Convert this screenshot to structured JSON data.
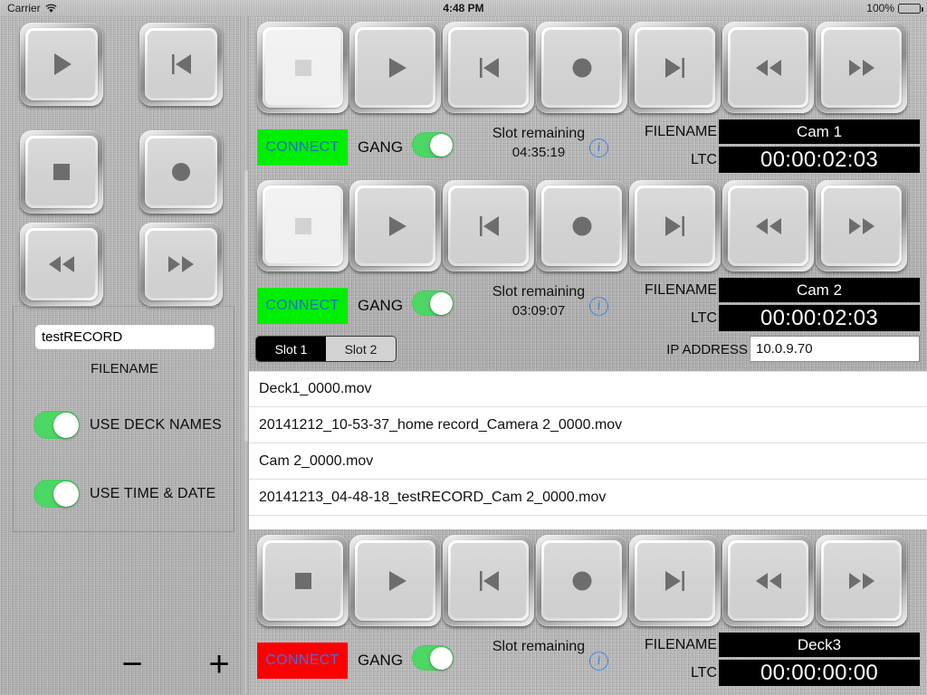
{
  "statusbar": {
    "carrier": "Carrier",
    "time": "4:48 PM",
    "battery_pct": "100%"
  },
  "sidebar": {
    "transport_keys": [
      {
        "name": "play",
        "icon": "play-icon"
      },
      {
        "name": "prev",
        "icon": "skip-previous-icon"
      },
      {
        "name": "stop",
        "icon": "stop-icon"
      },
      {
        "name": "record",
        "icon": "record-icon"
      },
      {
        "name": "rewind",
        "icon": "rewind-icon"
      },
      {
        "name": "forward",
        "icon": "fast-forward-icon"
      }
    ],
    "filename_value": "testRECORD",
    "filename_placeholder": "FILENAME",
    "filename_label": "FILENAME",
    "toggles": [
      {
        "label": "USE DECK NAMES",
        "on": true
      },
      {
        "label": "USE TIME & DATE",
        "on": true
      }
    ],
    "minus_label": "−",
    "plus_label": "+"
  },
  "main": {
    "transport_icons": [
      "stop-icon",
      "play-icon",
      "skip-previous-icon",
      "record-icon",
      "skip-next-icon",
      "rewind-icon",
      "fast-forward-icon"
    ],
    "labels": {
      "connect": "CONNECT",
      "gang": "GANG",
      "slot_remaining": "Slot remaining",
      "filename": "FILENAME",
      "ltc": "LTC",
      "info": "i",
      "ip_address": "IP ADDRESS"
    },
    "colors": {
      "connect_on_bg": "#00ef00",
      "connect_off_bg": "#fc0000",
      "connect_text": "#1e6fbe",
      "switch_on": "#4cd764",
      "display_bg": "#000000",
      "display_text": "#ffffff",
      "info_blue": "#3e86e0"
    },
    "decks": [
      {
        "connect_label": "CONNECT",
        "connected": true,
        "gang_on": true,
        "slot_remaining_label": "Slot remaining",
        "slot_remaining_value": "04:35:19",
        "filename_label": "FILENAME",
        "filename_value": "Cam 1",
        "ltc_label": "LTC",
        "ltc_value": "00:00:02:03",
        "active_transport": 0
      },
      {
        "connect_label": "CONNECT",
        "connected": true,
        "gang_on": true,
        "slot_remaining_label": "Slot remaining",
        "slot_remaining_value": "03:09:07",
        "filename_label": "FILENAME",
        "filename_value": "Cam 2",
        "ltc_label": "LTC",
        "ltc_value": "00:00:02:03",
        "active_transport": 0
      },
      {
        "connect_label": "CONNECT",
        "connected": false,
        "gang_on": true,
        "slot_remaining_label": "Slot remaining",
        "slot_remaining_value": "",
        "filename_label": "FILENAME",
        "filename_value": "Deck3",
        "ltc_label": "LTC",
        "ltc_value": "00:00:00:00",
        "active_transport": -1
      }
    ],
    "slot_segments": [
      {
        "label": "Slot 1",
        "selected": true
      },
      {
        "label": "Slot 2",
        "selected": false
      }
    ],
    "ip_label": "IP ADDRESS",
    "ip_value": "10.0.9.70",
    "files": [
      "Deck1_0000.mov",
      "20141212_10-53-37_home record_Camera 2_0000.mov",
      "Cam 2_0000.mov",
      " 20141213_04-48-18_testRECORD_Cam 2_0000.mov"
    ]
  }
}
